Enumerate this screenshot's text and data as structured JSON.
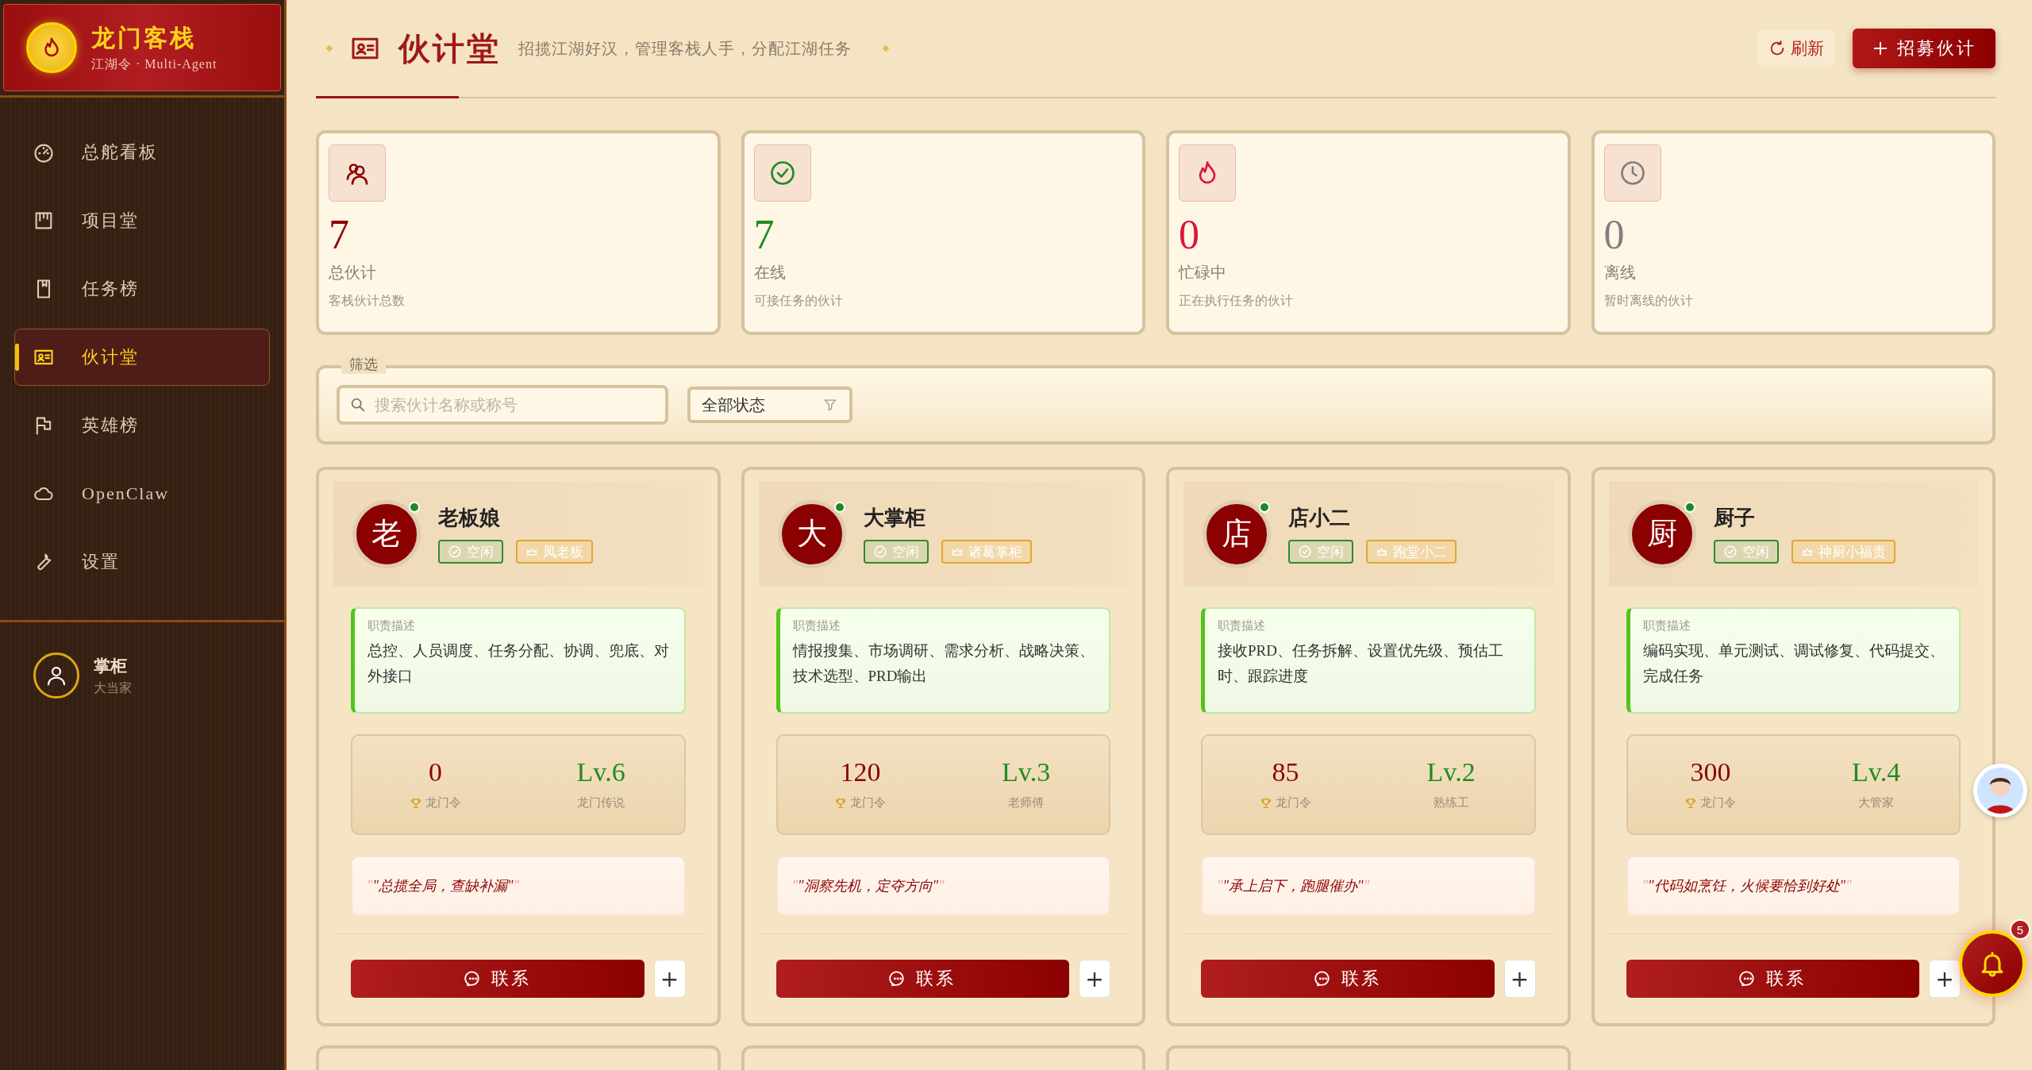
{
  "brand": {
    "title": "龙门客栈",
    "subtitle": "江湖令 · Multi-Agent"
  },
  "nav": [
    {
      "label": "总舵看板",
      "selected": false
    },
    {
      "label": "项目堂",
      "selected": false
    },
    {
      "label": "任务榜",
      "selected": false
    },
    {
      "label": "伙计堂",
      "selected": true
    },
    {
      "label": "英雄榜",
      "selected": false
    },
    {
      "label": "OpenClaw",
      "selected": false
    },
    {
      "label": "设置",
      "selected": false
    }
  ],
  "user": {
    "name": "掌柜",
    "role": "大当家"
  },
  "header": {
    "title": "伙计堂",
    "subtitle": "招揽江湖好汉，管理客栈人手，分配江湖任务",
    "refresh": "刷新",
    "recruit": "招募伙计"
  },
  "stats": [
    {
      "color": "#8b0000",
      "value": "7",
      "label": "总伙计",
      "hint": "客栈伙计总数"
    },
    {
      "color": "#228b22",
      "value": "7",
      "label": "在线",
      "hint": "可接任务的伙计"
    },
    {
      "color": "#dc143c",
      "value": "0",
      "label": "忙碌中",
      "hint": "正在执行任务的伙计"
    },
    {
      "color": "#808080",
      "value": "0",
      "label": "离线",
      "hint": "暂时离线的伙计"
    }
  ],
  "filter": {
    "legend": "筛选",
    "search_placeholder": "搜索伙计名称或称号",
    "status_select": "全部状态"
  },
  "members": [
    {
      "avatar": "老",
      "name": "老板娘",
      "online": true,
      "status": {
        "label": "空闲",
        "kind": "idle"
      },
      "title": "凤老板",
      "desc_label": "职责描述",
      "desc": "总控、人员调度、任务分配、协调、兜底、对外接口",
      "tokens": "0",
      "tokens_label": "龙门令",
      "level": "Lv.6",
      "rank": "龙门传说",
      "quote_marks": [
        "\"",
        "\""
      ],
      "quote": "\"总揽全局，查缺补漏\"",
      "contact": "联系",
      "add": "+"
    },
    {
      "avatar": "大",
      "name": "大掌柜",
      "online": true,
      "status": {
        "label": "空闲",
        "kind": "idle"
      },
      "title": "诸葛掌柜",
      "desc_label": "职责描述",
      "desc": "情报搜集、市场调研、需求分析、战略决策、技术选型、PRD输出",
      "tokens": "120",
      "tokens_label": "龙门令",
      "level": "Lv.3",
      "rank": "老师傅",
      "quote_marks": [
        "\"",
        "\""
      ],
      "quote": "\"洞察先机，定夺方向\"",
      "contact": "联系",
      "add": "+"
    },
    {
      "avatar": "店",
      "name": "店小二",
      "online": true,
      "status": {
        "label": "空闲",
        "kind": "idle"
      },
      "title": "跑堂小二",
      "desc_label": "职责描述",
      "desc": "接收PRD、任务拆解、设置优先级、预估工时、跟踪进度",
      "tokens": "85",
      "tokens_label": "龙门令",
      "level": "Lv.2",
      "rank": "熟练工",
      "quote_marks": [
        "\"",
        "\""
      ],
      "quote": "\"承上启下，跑腿催办\"",
      "contact": "联系",
      "add": "+"
    },
    {
      "avatar": "厨",
      "name": "厨子",
      "online": true,
      "status": {
        "label": "空闲",
        "kind": "idle"
      },
      "title": "神厨小福贵",
      "desc_label": "职责描述",
      "desc": "编码实现、单元测试、调试修复、代码提交、完成任务",
      "tokens": "300",
      "tokens_label": "龙门令",
      "level": "Lv.4",
      "rank": "大管家",
      "quote_marks": [
        "\"",
        "\""
      ],
      "quote": "\"代码如烹饪，火候要恰到好处\"",
      "contact": "联系",
      "add": "+"
    }
  ],
  "more_cards": [
    {
      "kind": "partial"
    },
    {
      "kind": "partial"
    },
    {
      "kind": "partial"
    }
  ],
  "notifications": {
    "count": "5"
  }
}
